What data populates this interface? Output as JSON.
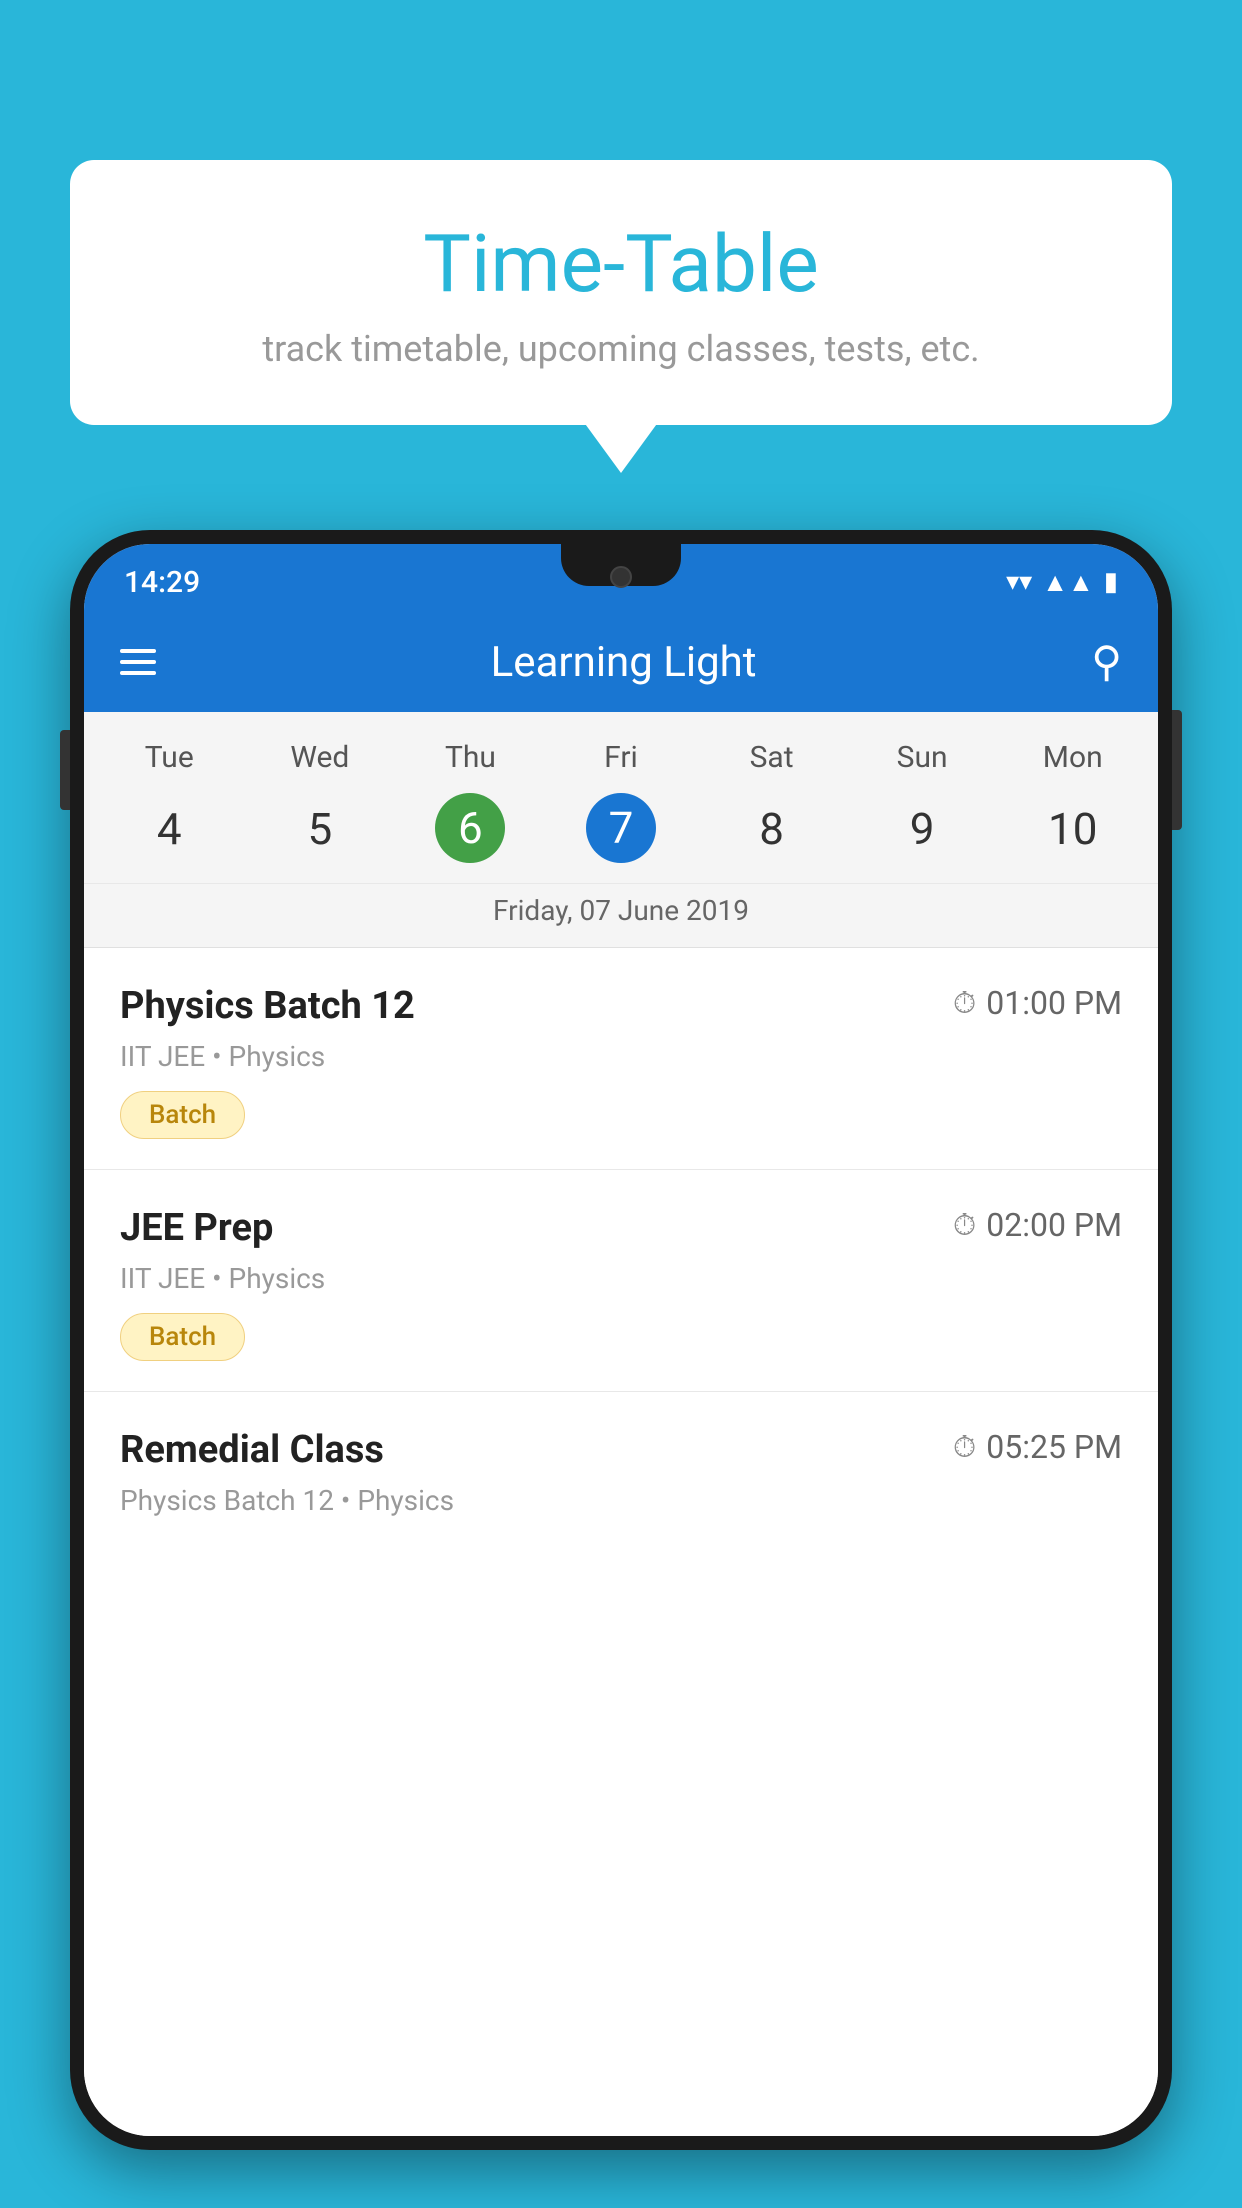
{
  "background_color": "#29B6D9",
  "speech_bubble": {
    "title": "Time-Table",
    "subtitle": "track timetable, upcoming classes, tests, etc."
  },
  "status_bar": {
    "time": "14:29"
  },
  "app_bar": {
    "title": "Learning Light"
  },
  "calendar": {
    "days": [
      "Tue",
      "Wed",
      "Thu",
      "Fri",
      "Sat",
      "Sun",
      "Mon"
    ],
    "dates": [
      "4",
      "5",
      "6",
      "7",
      "8",
      "9",
      "10"
    ],
    "today_index": 2,
    "selected_index": 3,
    "selected_date_label": "Friday, 07 June 2019"
  },
  "schedule": [
    {
      "title": "Physics Batch 12",
      "time": "01:00 PM",
      "meta": "IIT JEE • Physics",
      "tag": "Batch"
    },
    {
      "title": "JEE Prep",
      "time": "02:00 PM",
      "meta": "IIT JEE • Physics",
      "tag": "Batch"
    },
    {
      "title": "Remedial Class",
      "time": "05:25 PM",
      "meta": "Physics Batch 12 • Physics",
      "tag": ""
    }
  ],
  "icons": {
    "hamburger": "☰",
    "search": "🔍",
    "clock": "🕐"
  }
}
